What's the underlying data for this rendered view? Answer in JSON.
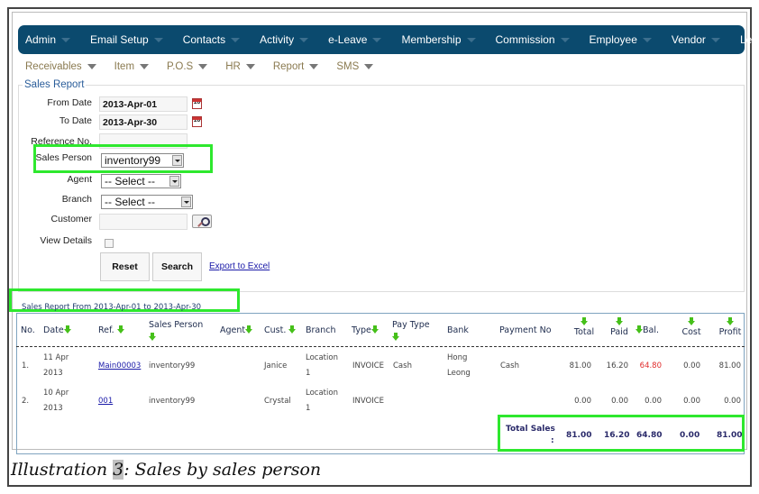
{
  "topnav": {
    "items": [
      {
        "label": "Admin"
      },
      {
        "label": "Email Setup"
      },
      {
        "label": "Contacts"
      },
      {
        "label": "Activity"
      },
      {
        "label": "e-Leave"
      },
      {
        "label": "Membership"
      },
      {
        "label": "Commission"
      },
      {
        "label": "Employee"
      },
      {
        "label": "Vendor"
      },
      {
        "label": "Ledger"
      }
    ],
    "color": "#0b4a6e"
  },
  "subnav": {
    "items": [
      {
        "label": "Receivables"
      },
      {
        "label": "Item"
      },
      {
        "label": "P.O.S"
      },
      {
        "label": "HR"
      },
      {
        "label": "Report"
      },
      {
        "label": "SMS"
      }
    ]
  },
  "form": {
    "legend": "Sales Report",
    "from_date_label": "From Date",
    "from_date_value": "2013-Apr-01",
    "to_date_label": "To Date",
    "to_date_value": "2013-Apr-30",
    "calendar_day": "10",
    "reference_label": "Reference No.",
    "reference_value": "",
    "sales_person_label": "Sales Person",
    "sales_person_value": "inventory99",
    "agent_label": "Agent",
    "agent_value": "-- Select --",
    "branch_label": "Branch",
    "branch_value": "-- Select --",
    "customer_label": "Customer",
    "customer_value": "",
    "view_details_label": "View Details",
    "view_details_checked": false,
    "reset_label": "Reset",
    "search_label": "Search",
    "export_label": "Export to Excel"
  },
  "report": {
    "title": "Sales Report From 2013-Apr-01 to 2013-Apr-30",
    "columns": [
      "No.",
      "Date",
      "Ref.",
      "Sales Person",
      "Agent",
      "Cust.",
      "Branch",
      "Type",
      "Pay Type",
      "Bank",
      "Payment No",
      "Total",
      "Paid",
      "Bal.",
      "Cost",
      "Profit"
    ],
    "rows": [
      {
        "no": "1.",
        "date1": "11 Apr",
        "date2": "2013",
        "ref": "Main00003",
        "sales_person": "inventory99",
        "agent": "",
        "cust": "Janice",
        "branch1": "Location",
        "branch2": "1",
        "type": "INVOICE",
        "pay_type": "Cash",
        "bank1": "Hong",
        "bank2": "Leong",
        "payment_no": "Cash",
        "total": "81.00",
        "paid": "16.20",
        "bal": "64.80",
        "cost": "0.00",
        "profit": "81.00"
      },
      {
        "no": "2.",
        "date1": "10 Apr",
        "date2": "2013",
        "ref": "001",
        "sales_person": "inventory99",
        "agent": "",
        "cust": "Crystal",
        "branch1": "Location",
        "branch2": "1",
        "type": "INVOICE",
        "pay_type": "",
        "bank1": "",
        "bank2": "",
        "payment_no": "",
        "total": "0.00",
        "paid": "0.00",
        "bal": "0.00",
        "cost": "0.00",
        "profit": "0.00"
      }
    ],
    "totals": {
      "label": "Total Sales",
      "colon": ":",
      "total": "81.00",
      "paid": "16.20",
      "bal": "64.80",
      "cost": "0.00",
      "profit": "81.00"
    },
    "balance_color": "#e02a2a",
    "highlight_color": "#2ee82e"
  },
  "caption": {
    "prefix": "Illustration ",
    "number": "3",
    "suffix": ": Sales by sales person"
  }
}
